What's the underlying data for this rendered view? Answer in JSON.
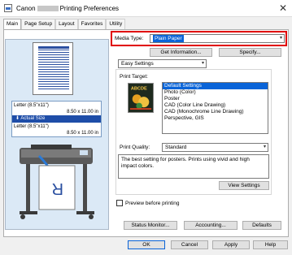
{
  "window": {
    "title_left": "Canon",
    "title_right": "Printing Preferences"
  },
  "tabs": [
    {
      "label": "Main"
    },
    {
      "label": "Page Setup"
    },
    {
      "label": "Layout"
    },
    {
      "label": "Favorites"
    },
    {
      "label": "Utility"
    }
  ],
  "preview": {
    "paper_line": "Letter (8.5\"x11\")",
    "paper_dims": "8.50 x 11.00 in",
    "actual_size_label": "Actual Size",
    "actual_line": "Letter (8.5\"x11\")",
    "actual_dims": "8.50 x 11.00 in"
  },
  "media_type": {
    "label": "Media Type:",
    "value": "Plain Paper"
  },
  "buttons": {
    "get_information": "Get Information...",
    "specify": "Specify...",
    "view_settings": "View Settings",
    "status_monitor": "Status Monitor...",
    "accounting": "Accounting...",
    "defaults": "Defaults",
    "ok": "OK",
    "cancel": "Cancel",
    "apply": "Apply",
    "help": "Help"
  },
  "settings_mode": {
    "value": "Easy Settings"
  },
  "print_target": {
    "label": "Print Target:",
    "items": [
      "Default Settings",
      "Photo (Color)",
      "Poster",
      "CAD (Color Line Drawing)",
      "CAD (Monochrome Line Drawing)",
      "Perspective, GIS"
    ],
    "selected_index": 0
  },
  "print_quality": {
    "label": "Print Quality:",
    "value": "Standard"
  },
  "description": "The best setting for posters. Prints using vivid and high impact colors.",
  "preview_before_printing": {
    "label": "Preview before printing",
    "checked": false
  },
  "colors": {
    "accent": "#0a64d8",
    "highlight_frame": "#e00000",
    "actual_size_bar": "#1e4da8"
  }
}
